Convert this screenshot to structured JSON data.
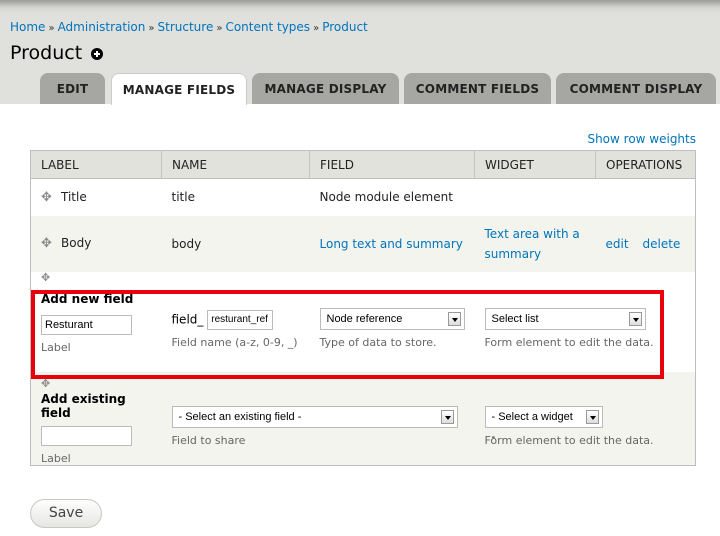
{
  "breadcrumb": [
    "Home",
    "Administration",
    "Structure",
    "Content types",
    "Product"
  ],
  "breadcrumb_separator": "»",
  "page": {
    "title": "Product",
    "add_shortcut_icon": "plus-circle-icon"
  },
  "tabs": [
    {
      "label": "EDIT",
      "active": false
    },
    {
      "label": "MANAGE FIELDS",
      "active": true
    },
    {
      "label": "MANAGE DISPLAY",
      "active": false
    },
    {
      "label": "COMMENT FIELDS",
      "active": false
    },
    {
      "label": "COMMENT DISPLAY",
      "active": false
    }
  ],
  "show_row_weights": "Show row weights",
  "table": {
    "headers": [
      "LABEL",
      "NAME",
      "FIELD",
      "WIDGET",
      "OPERATIONS"
    ],
    "rows": [
      {
        "label": "Title",
        "name": "title",
        "field": "Node module element",
        "widget": "",
        "edit": "",
        "delete": ""
      },
      {
        "label": "Body",
        "name": "body",
        "field": "Long text and summary",
        "widget_line1": "Text area with a",
        "widget_line2": "summary",
        "edit": "edit",
        "delete": "delete"
      }
    ]
  },
  "add_new_field": {
    "heading": "Add new field",
    "label_value": "Resturant",
    "label_caption": "Label",
    "name_prefix": "field_",
    "name_value": "resturant_ref",
    "name_caption": "Field name (a-z, 0-9, _)",
    "type_selected": "Node reference",
    "type_caption": "Type of data to store.",
    "widget_selected": "Select list",
    "widget_caption": "Form element to edit the data."
  },
  "add_existing_field": {
    "heading": "Add existing field",
    "label_value": "",
    "label_caption": "Label",
    "field_selected": "- Select an existing field -",
    "field_caption": "Field to share",
    "widget_selected": "- Select a widget -",
    "widget_caption": "Form element to edit the data."
  },
  "save_label": "Save",
  "colors": {
    "link": "#0074bd",
    "highlight": "#e8000b",
    "tab_inactive": "#a6a6a2",
    "header_bg": "#e1e2dc"
  }
}
